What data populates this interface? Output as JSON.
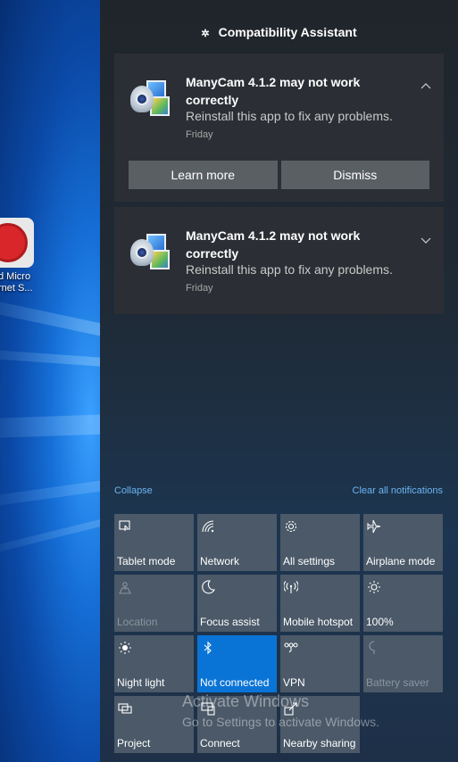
{
  "desktop": {
    "icon_label_line1": "d Micro",
    "icon_label_line2": "rnet S..."
  },
  "action_center": {
    "group_header": "Compatibility Assistant",
    "notifications": [
      {
        "title": "ManyCam 4.1.2 may not work correctly",
        "body": "Reinstall this app to fix any problems.",
        "time": "Friday",
        "expanded": true,
        "actions": [
          "Learn more",
          "Dismiss"
        ]
      },
      {
        "title": "ManyCam 4.1.2 may not work correctly",
        "body": "Reinstall this app to fix any problems.",
        "time": "Friday",
        "expanded": false
      }
    ],
    "collapse_label": "Collapse",
    "clear_all_label": "Clear all notifications",
    "quick_actions": [
      {
        "label": "Tablet mode",
        "icon": "tablet-mode-icon",
        "state": "off"
      },
      {
        "label": "Network",
        "icon": "network-icon",
        "state": "off"
      },
      {
        "label": "All settings",
        "icon": "gear-icon",
        "state": "off"
      },
      {
        "label": "Airplane mode",
        "icon": "airplane-icon",
        "state": "off"
      },
      {
        "label": "Location",
        "icon": "location-icon",
        "state": "disabled"
      },
      {
        "label": "Focus assist",
        "icon": "moon-icon",
        "state": "off"
      },
      {
        "label": "Mobile hotspot",
        "icon": "hotspot-icon",
        "state": "off"
      },
      {
        "label": "100%",
        "icon": "brightness-icon",
        "state": "off"
      },
      {
        "label": "Night light",
        "icon": "night-light-icon",
        "state": "off"
      },
      {
        "label": "Not connected",
        "icon": "bluetooth-icon",
        "state": "on"
      },
      {
        "label": "VPN",
        "icon": "vpn-icon",
        "state": "off"
      },
      {
        "label": "Battery saver",
        "icon": "battery-saver-icon",
        "state": "disabled"
      },
      {
        "label": "Project",
        "icon": "project-icon",
        "state": "off"
      },
      {
        "label": "Connect",
        "icon": "connect-icon",
        "state": "off"
      },
      {
        "label": "Nearby sharing",
        "icon": "nearby-sharing-icon",
        "state": "off"
      }
    ]
  },
  "watermark": {
    "line1": "Activate Windows",
    "line2": "Go to Settings to activate Windows."
  },
  "colors": {
    "accent": "#0a74d6",
    "link": "#6cb4f0",
    "tile": "#4b5968",
    "notification_bg": "#2b2f35"
  }
}
